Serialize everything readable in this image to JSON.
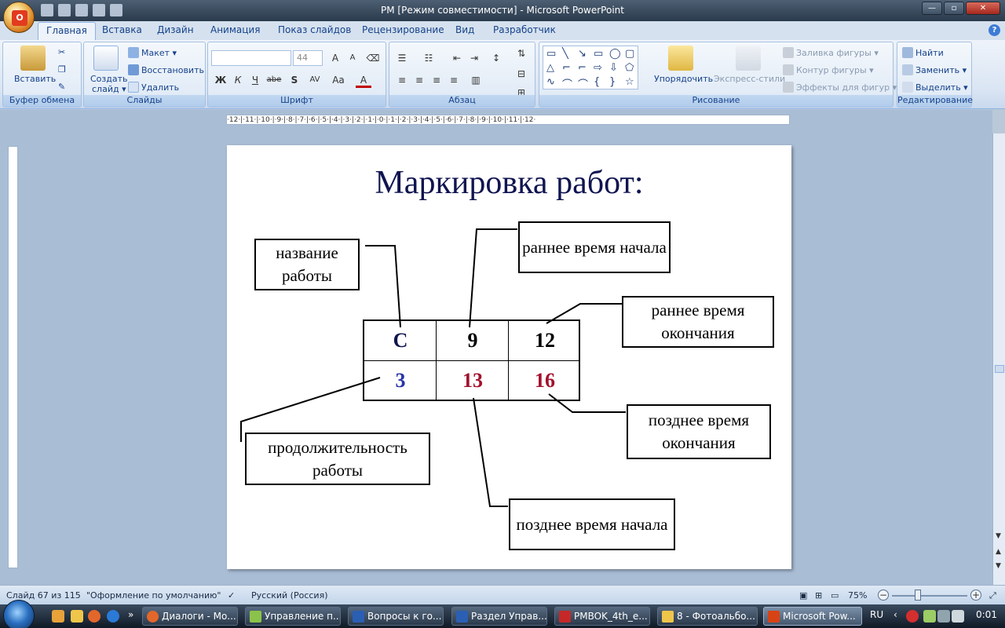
{
  "window": {
    "title": "PM [Режим совместимости] - Microsoft PowerPoint",
    "controls": {
      "minimize": "—",
      "maximize": "▫",
      "close": "✕"
    }
  },
  "tabs": [
    "Главная",
    "Вставка",
    "Дизайн",
    "Анимация",
    "Показ слайдов",
    "Рецензирование",
    "Вид",
    "Разработчик"
  ],
  "help_icon": "?",
  "ribbon": {
    "clipboard": {
      "label": "Буфер обмена",
      "paste": "Вставить"
    },
    "slides": {
      "label": "Слайды",
      "new_slide_1": "Создать",
      "new_slide_2": "слайд ▾",
      "layout": "Макет ▾",
      "reset": "Восстановить",
      "delete": "Удалить"
    },
    "font": {
      "label": "Шрифт",
      "size": "44",
      "bold": "Ж",
      "italic": "К",
      "underline": "Ч",
      "strike": "abe",
      "shadow": "S",
      "spacing": "AV",
      "case": "Aa",
      "color": "A",
      "grow": "A",
      "shrink": "A"
    },
    "paragraph": {
      "label": "Абзац"
    },
    "drawing": {
      "label": "Рисование",
      "arrange": "Упорядочить",
      "quick_styles": "Экспресс-стили",
      "fill": "Заливка фигуры ▾",
      "outline": "Контур фигуры ▾",
      "effects": "Эффекты для фигур ▾"
    },
    "editing": {
      "label": "Редактирование",
      "find": "Найти",
      "replace": "Заменить ▾",
      "select": "Выделить ▾"
    }
  },
  "ruler": {
    "horizontal": "·12·|·11·|·10·|·9·|·8·|·7·|·6·|·5·|·4·|·3·|·2·|·1·|·0·|·1·|·2·|·3·|·4·|·5·|·6·|·7·|·8·|·9·|·10·|·11·|·12·"
  },
  "slide": {
    "title": "Маркировка работ:",
    "labels": {
      "name": "название работы",
      "early_start": "раннее время начала",
      "early_finish": "раннее время окончания",
      "late_finish": "позднее время окончания",
      "duration": "продолжительность работы",
      "late_start": "позднее время начала"
    },
    "cells": {
      "name": "C",
      "early_start": "9",
      "early_finish": "12",
      "duration": "3",
      "late_start": "13",
      "late_finish": "16"
    },
    "colors": {
      "title": "#101450",
      "top_row": "#000000",
      "duration": "#2a35a8",
      "late_values": "#a3122e",
      "name_cell": "#101450"
    }
  },
  "status": {
    "slide_counter": "Слайд 67 из 115",
    "theme": "\"Оформление по умолчанию\"",
    "language": "Русский (Россия)",
    "zoom": "75%"
  },
  "taskbar": {
    "tasks": [
      "Диалоги - Мо...",
      "Управление п...",
      "Вопросы к го...",
      "Раздел Управ...",
      "PMBOK_4th_e...",
      "8 - Фотоальбо...",
      "Microsoft Pow..."
    ],
    "lang": "RU",
    "clock": "0:01"
  }
}
